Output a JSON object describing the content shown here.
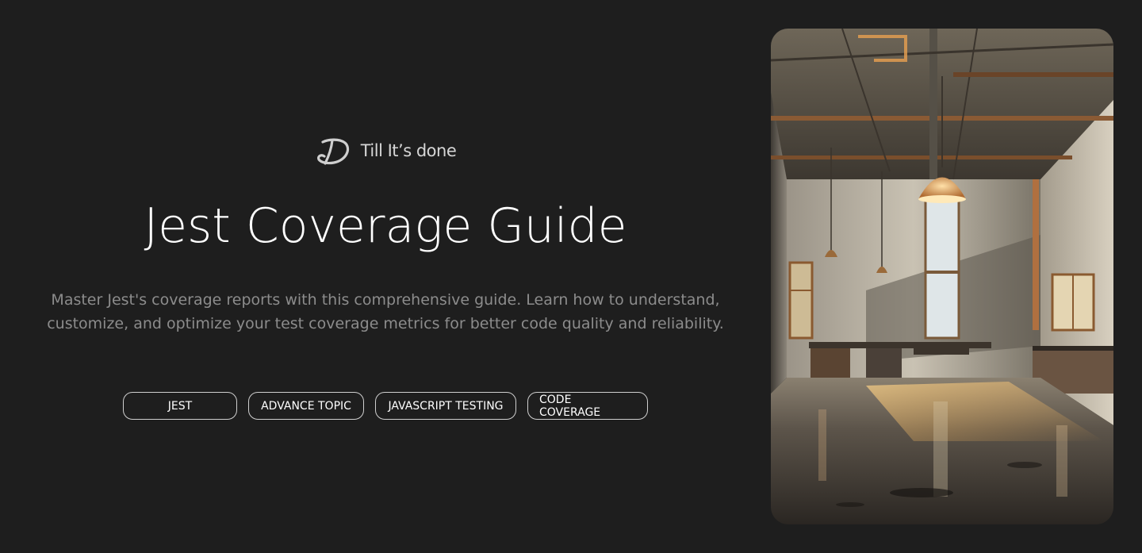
{
  "brand": {
    "logo_icon": "td-monogram-icon",
    "name": "Till It’s done"
  },
  "hero": {
    "title": "Jest Coverage Guide",
    "description": "Master Jest's coverage reports with this comprehensive guide. Learn how to understand, customize, and optimize your test coverage metrics for better code quality and reliability.",
    "tags": [
      "JEST",
      "ADVANCE TOPIC",
      "JAVASCRIPT TESTING",
      "CODE COVERAGE"
    ]
  },
  "image": {
    "subject": "industrial-interior-photo"
  },
  "colors": {
    "background": "#1e1e1e",
    "title": "#ffffff",
    "description": "#8c8c8c",
    "tag_border": "#cfcfcf"
  }
}
